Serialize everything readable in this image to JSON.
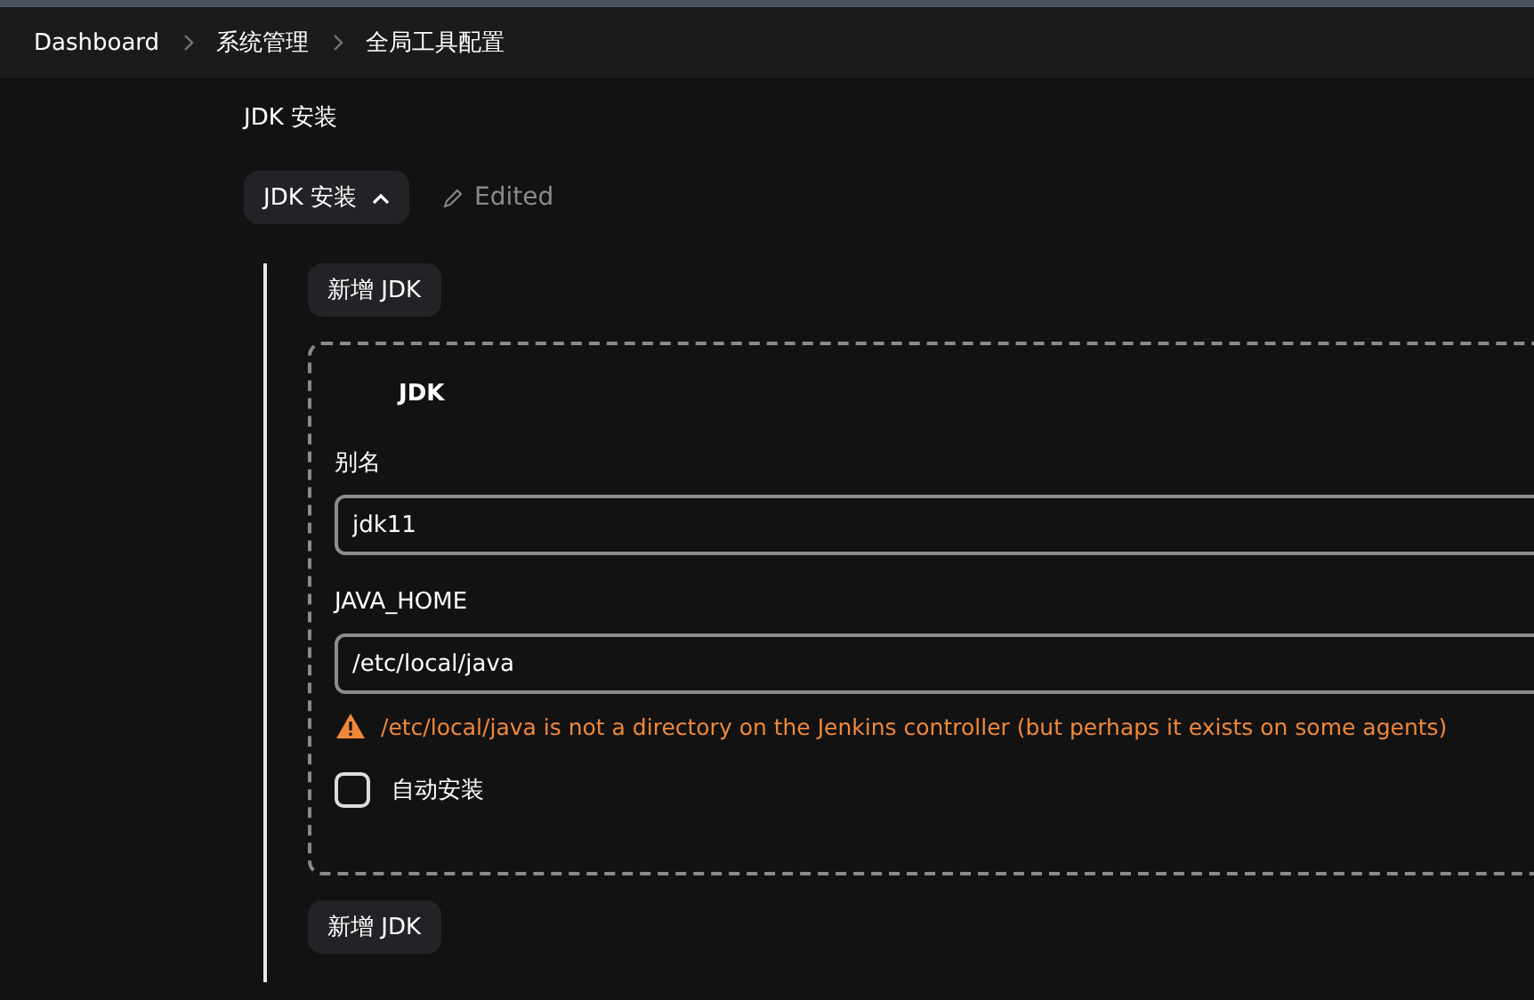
{
  "breadcrumbs": [
    {
      "label": "Dashboard"
    },
    {
      "label": "系统管理"
    },
    {
      "label": "全局工具配置"
    }
  ],
  "section_title": "JDK 安装",
  "toggle": {
    "label": "JDK 安装",
    "expanded": true
  },
  "edited": "Edited",
  "add_button_top": "新增 JDK",
  "installation": {
    "title": "JDK",
    "fields": [
      {
        "label": "别名",
        "value": "jdk11"
      },
      {
        "label": "JAVA_HOME",
        "value": "/etc/local/java",
        "warning": "/etc/local/java is not a directory on the Jenkins controller (but perhaps it exists on some agents)"
      }
    ],
    "auto_install": {
      "label": "自动安装",
      "checked": false
    }
  },
  "add_button_bottom": "新增 JDK"
}
